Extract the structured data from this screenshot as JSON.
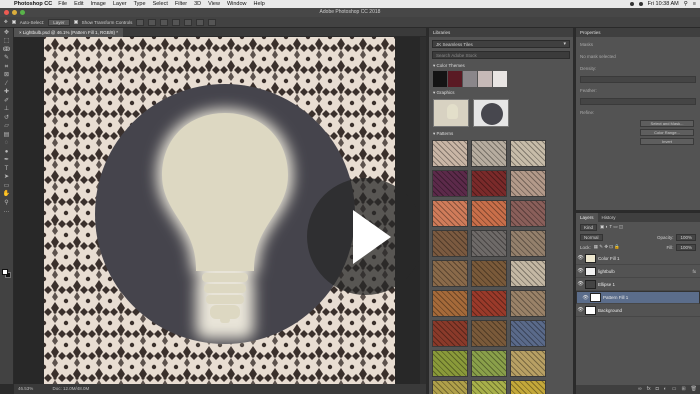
{
  "menubar": {
    "app_name": "Photoshop CC",
    "menus": [
      "File",
      "Edit",
      "Image",
      "Layer",
      "Type",
      "Select",
      "Filter",
      "3D",
      "View",
      "Window",
      "Help"
    ],
    "clock": "Fri 10:38 AM"
  },
  "window": {
    "title": "Adobe Photoshop CC 2018"
  },
  "options_bar": {
    "auto_select_label": "Auto-Select:",
    "auto_select_value": "Layer",
    "transform_label": "Show Transform Controls"
  },
  "document": {
    "tab_title": "Lightbulb.psd @ 46.1% (Pattern Fill 1, RGB/8) *",
    "zoom": "46.53%",
    "doc_info": "Doc: 12.0M/48.0M"
  },
  "libraries": {
    "panel_title": "Libraries",
    "library_name": "JK Seamless Tiles",
    "search_placeholder": "Search Adobe Stock",
    "colors_label": "Color Themes",
    "colors": [
      "#141414",
      "#5a1a24",
      "#8a868a",
      "#c6b9b7",
      "#e9e5e3"
    ],
    "graphics_label": "Graphics",
    "patterns_label": "Patterns",
    "pattern_colors": [
      [
        "#c9b6a6",
        "#b7ada0",
        "#c7bca9"
      ],
      [
        "#5c2a4a",
        "#7a2a2a",
        "#b39a8a"
      ],
      [
        "#d07c5a",
        "#c96f4a",
        "#8a5f5a"
      ],
      [
        "#7b5a40",
        "#6e6a68",
        "#94806c"
      ],
      [
        "#8a6a4a",
        "#7a5a3a",
        "#c4b8a4"
      ],
      [
        "#a56a3a",
        "#9a3a2a",
        "#9a8268"
      ],
      [
        "#8a3a2a",
        "#7a5a3a",
        "#5a6a8a"
      ],
      [
        "#8a9a3a",
        "#8aa04a",
        "#b8a064"
      ],
      [
        "#b0a04a",
        "#a8b04a",
        "#c4a83a"
      ]
    ]
  },
  "properties": {
    "panel_title": "Properties",
    "subtitle": "Masks",
    "no_mask": "No mask selected",
    "density_label": "Density:",
    "feather_label": "Feather:",
    "refine_label": "Refine:",
    "select_mask_btn": "Select and Mask...",
    "color_range_btn": "Color Range...",
    "invert_btn": "Invert"
  },
  "layers_panel": {
    "tab_layers": "Layers",
    "tab_history": "History",
    "kind_label": "Kind",
    "blend_mode": "Normal",
    "opacity_label": "Opacity:",
    "opacity_value": "100%",
    "lock_label": "Lock:",
    "fill_label": "Fill:",
    "fill_value": "100%",
    "layers": [
      {
        "name": "Color Fill 1",
        "thumb": "#ede7cf",
        "selected": false,
        "fx": false
      },
      {
        "name": "lightbulb",
        "thumb": "#f0f0f0",
        "selected": false,
        "fx": true
      },
      {
        "name": "Ellipse 1",
        "thumb": "#444444",
        "selected": false,
        "fx": false
      },
      {
        "name": "Pattern Fill 1",
        "thumb": "#ffffff",
        "selected": true,
        "fx": false
      },
      {
        "name": "Background",
        "thumb": "#ffffff",
        "selected": false,
        "fx": false
      }
    ]
  },
  "colors": {
    "pattern_bg": "#e8ddd2",
    "pattern_dark": "#3a302c",
    "circle": "#45444c",
    "bulb": "#ddd8c2",
    "glow": "#e8e4d8"
  }
}
